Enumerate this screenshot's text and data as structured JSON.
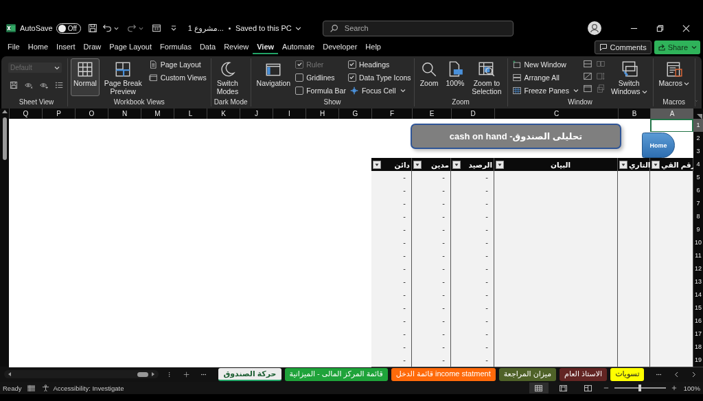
{
  "title_bar": {
    "autosave_label": "AutoSave",
    "autosave": {
      "on": false,
      "label": "Off"
    },
    "document_title": "مشروع 1...",
    "save_status": "Saved to this PC",
    "search": {
      "placeholder": "Search"
    }
  },
  "menu": [
    {
      "label": "File",
      "selected": false
    },
    {
      "label": "Home",
      "selected": false
    },
    {
      "label": "Insert",
      "selected": false
    },
    {
      "label": "Draw",
      "selected": false
    },
    {
      "label": "Page Layout",
      "selected": false
    },
    {
      "label": "Formulas",
      "selected": false
    },
    {
      "label": "Data",
      "selected": false
    },
    {
      "label": "Review",
      "selected": false
    },
    {
      "label": "View",
      "selected": true
    },
    {
      "label": "Automate",
      "selected": false
    },
    {
      "label": "Developer",
      "selected": false
    },
    {
      "label": "Help",
      "selected": false
    }
  ],
  "menu_actions": {
    "comments": "Comments",
    "share": "Share"
  },
  "ribbon": [
    {
      "label": "Sheet View",
      "columns": [
        [
          {
            "kind": "dropdown",
            "value": "Default",
            "disabled": true
          },
          {
            "kind": "iconrow"
          }
        ]
      ]
    },
    {
      "label": "Workbook Views",
      "columns": [
        [
          {
            "kind": "large",
            "label": "Normal",
            "selected": true
          }
        ],
        [
          {
            "kind": "large",
            "label": "Page Break\nPreview",
            "selected": false
          }
        ],
        [
          {
            "kind": "small",
            "label": "Page Layout",
            "selected": false
          },
          {
            "kind": "small",
            "label": "Custom Views"
          }
        ]
      ]
    },
    {
      "label": "Dark Mode",
      "columns": [
        [
          {
            "kind": "large",
            "label": "Switch\nModes"
          }
        ]
      ]
    },
    {
      "label": "Show",
      "columns": [
        [
          {
            "kind": "large",
            "label": "Navigation"
          }
        ],
        [
          {
            "kind": "check",
            "label": "Ruler",
            "checked": true,
            "disabled": true
          },
          {
            "kind": "check",
            "label": "Gridlines",
            "checked": false,
            "disabled": false
          },
          {
            "kind": "check",
            "label": "Formula Bar",
            "checked": false,
            "disabled": false
          }
        ],
        [
          {
            "kind": "check",
            "label": "Headings",
            "checked": true,
            "disabled": false
          },
          {
            "kind": "check",
            "label": "Data Type Icons",
            "checked": true,
            "disabled": false
          },
          {
            "kind": "small",
            "label": "Focus Cell",
            "caret": true
          }
        ]
      ]
    },
    {
      "label": "Zoom",
      "columns": [
        [
          {
            "kind": "large",
            "label": "Zoom"
          }
        ],
        [
          {
            "kind": "large",
            "label": "100%"
          }
        ],
        [
          {
            "kind": "large",
            "label": "Zoom to\nSelection"
          }
        ]
      ]
    },
    {
      "label": "Window",
      "columns": [
        [
          {
            "kind": "small",
            "label": "New Window"
          },
          {
            "kind": "small",
            "label": "Arrange All"
          },
          {
            "kind": "small",
            "label": "Freeze Panes",
            "caret": true
          }
        ],
        [
          {
            "kind": "icon",
            "disabled": false
          },
          {
            "kind": "icon",
            "disabled": false
          },
          {
            "kind": "icon",
            "disabled": false
          }
        ],
        [
          {
            "kind": "icon",
            "disabled": true
          },
          {
            "kind": "icon",
            "disabled": true
          },
          {
            "kind": "icon",
            "disabled": true
          }
        ],
        [
          {
            "kind": "large",
            "label": "Switch\nWindows",
            "caret": true
          }
        ]
      ]
    },
    {
      "label": "Macros",
      "columns": [
        [
          {
            "kind": "large",
            "label": "Macros",
            "caret": true
          }
        ]
      ]
    }
  ],
  "sheet": {
    "columns": [
      {
        "letter": "Q",
        "selected": false
      },
      {
        "letter": "P",
        "selected": false
      },
      {
        "letter": "O",
        "selected": false
      },
      {
        "letter": "N",
        "selected": false
      },
      {
        "letter": "M",
        "selected": false
      },
      {
        "letter": "L",
        "selected": false
      },
      {
        "letter": "K",
        "selected": false
      },
      {
        "letter": "J",
        "selected": false
      },
      {
        "letter": "I",
        "selected": false
      },
      {
        "letter": "H",
        "selected": false
      },
      {
        "letter": "G",
        "selected": false
      },
      {
        "letter": "F",
        "selected": false
      },
      {
        "letter": "E",
        "selected": false
      },
      {
        "letter": "D",
        "selected": false
      },
      {
        "letter": "C",
        "selected": false
      },
      {
        "letter": "B",
        "selected": false
      },
      {
        "letter": "A",
        "selected": true
      }
    ],
    "title_shape": "تحليلى الصندوق- cash on hand",
    "home_button": "Home",
    "top_rows": [
      {
        "number": "1",
        "selected": true
      },
      {
        "number": "2",
        "selected": false
      },
      {
        "number": "3",
        "selected": false
      }
    ],
    "header_row": {
      "number": "4",
      "selected": false,
      "cells": [
        "رقم القي",
        "التاري",
        "البيان",
        "الرصيد",
        "مدين",
        "دائن"
      ]
    },
    "data_rows": [
      {
        "number": "5",
        "selected": false,
        "balance": "-",
        "debit": "-",
        "credit": "-"
      },
      {
        "number": "6",
        "selected": false,
        "balance": "-",
        "debit": "-",
        "credit": "-"
      },
      {
        "number": "7",
        "selected": false,
        "balance": "-",
        "debit": "-",
        "credit": "-"
      },
      {
        "number": "8",
        "selected": false,
        "balance": "-",
        "debit": "-",
        "credit": "-"
      },
      {
        "number": "9",
        "selected": false,
        "balance": "-",
        "debit": "-",
        "credit": "-"
      },
      {
        "number": "10",
        "selected": false,
        "balance": "-",
        "debit": "-",
        "credit": "-"
      },
      {
        "number": "11",
        "selected": false,
        "balance": "-",
        "debit": "-",
        "credit": "-"
      },
      {
        "number": "12",
        "selected": false,
        "balance": "-",
        "debit": "-",
        "credit": "-"
      },
      {
        "number": "13",
        "selected": false,
        "balance": "-",
        "debit": "-",
        "credit": "-"
      },
      {
        "number": "14",
        "selected": false,
        "balance": "-",
        "debit": "-",
        "credit": "-"
      },
      {
        "number": "15",
        "selected": false,
        "balance": "-",
        "debit": "-",
        "credit": "-"
      },
      {
        "number": "16",
        "selected": false,
        "balance": "-",
        "debit": "-",
        "credit": "-"
      },
      {
        "number": "17",
        "selected": false,
        "balance": "-",
        "debit": "-",
        "credit": "-"
      },
      {
        "number": "18",
        "selected": false,
        "balance": "-",
        "debit": "-",
        "credit": "-"
      },
      {
        "number": "19",
        "selected": false,
        "balance": "-",
        "debit": "-",
        "credit": "-"
      }
    ]
  },
  "sheet_tabs": [
    {
      "label": "تسويات",
      "selected": false,
      "color": "#ffff00"
    },
    {
      "label": "الاستاذ العام",
      "selected": false,
      "color": "#632523"
    },
    {
      "label": "ميزان المراجعة",
      "selected": false,
      "color": "#4f6228"
    },
    {
      "label": "قائمة الدخل income statment",
      "selected": false,
      "color": "#ff6a0a"
    },
    {
      "label": "قائمة المركز المالى - الميزانية",
      "selected": false,
      "color": "#1fa33a"
    },
    {
      "label": "حركة الصندوق",
      "selected": true,
      "color": "#21a366"
    }
  ],
  "status_bar": {
    "ready": "Ready",
    "accessibility": "Accessibility: Investigate",
    "views": [
      {
        "selected": true
      },
      {
        "selected": false
      },
      {
        "selected": false
      }
    ],
    "zoom": {
      "level": 0.5,
      "label": "100%"
    }
  }
}
